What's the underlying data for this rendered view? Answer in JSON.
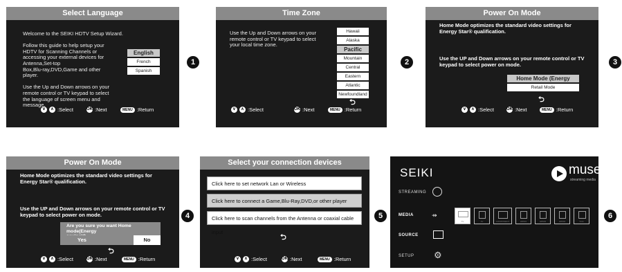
{
  "nav": {
    "select": ":Select",
    "next": ":Next",
    "return": ":Return",
    "select_sym": "⌄ ⌃",
    "ok": "OK",
    "menu": "MENU"
  },
  "s1": {
    "title": "Select Language",
    "para": "Welcome to the SEIKI HDTV Setup Wizard.\n\nFollow this guide to help setup your\nHDTV for Scanning Channels or\naccessing your external devices for\nAntenna,Set-top\nBox,Blu-ray,DVD,Game and other\nplayer.\n\nUse the Up and Down arrows on your\nremote control or TV keypad to select\nthe language of screen menu and\nmessage.",
    "options": [
      "English",
      "French",
      "Spanish"
    ]
  },
  "s2": {
    "title": "Time Zone",
    "para": "Use the Up and Down arrows on your\nremote control or TV keypad to select\nyour local time zone.",
    "options": [
      "Hawaii",
      "Alaska",
      "Pacific",
      "Mountain",
      "Central",
      "Eastern",
      "Atlantic",
      "Newfoundland"
    ]
  },
  "s3": {
    "title": "Power On Mode",
    "para1": "Home Mode optimizes the standard video settings for\nEnergy Star® qualification.",
    "para2": "Use the UP and Down arrows on your remote control or TV\nkeypad to select power on mode.",
    "options": [
      "Home Mode (Energy Saving)",
      "Retail Mode"
    ]
  },
  "s4": {
    "title": "Power On Mode",
    "para1": "Home Mode optimizes the standard video settings for\nEnergy Star® qualification.",
    "para2": "Use the UP and Down arrows on your remote control or TV\nkeypad to select power on mode.",
    "confirm": "Are you sure you want Home mode(Energy\nsaving)?",
    "yes": "Yes",
    "no": "No"
  },
  "s5": {
    "title": "Select your connection devices",
    "options": [
      "Click here to set network Lan or Wireless",
      "Click here to connect a Game,Blu-Ray,DVD,or other player",
      "Click here to scan channels from the Antenna or coaxial cable input"
    ]
  },
  "s6": {
    "brand": "SEIKI",
    "logo": "muse",
    "logo_sub": "streaming media",
    "menu": [
      "STREAMING",
      "MEDIA",
      "SOURCE",
      "SETUP"
    ],
    "sources": [
      "TV",
      "AV",
      "COMPONENT",
      "HDMI1",
      "HDMI2",
      "HDMI3",
      "VGA"
    ]
  },
  "badges": [
    "1",
    "2",
    "3",
    "4",
    "5",
    "6"
  ],
  "back_symbol": "⮌"
}
